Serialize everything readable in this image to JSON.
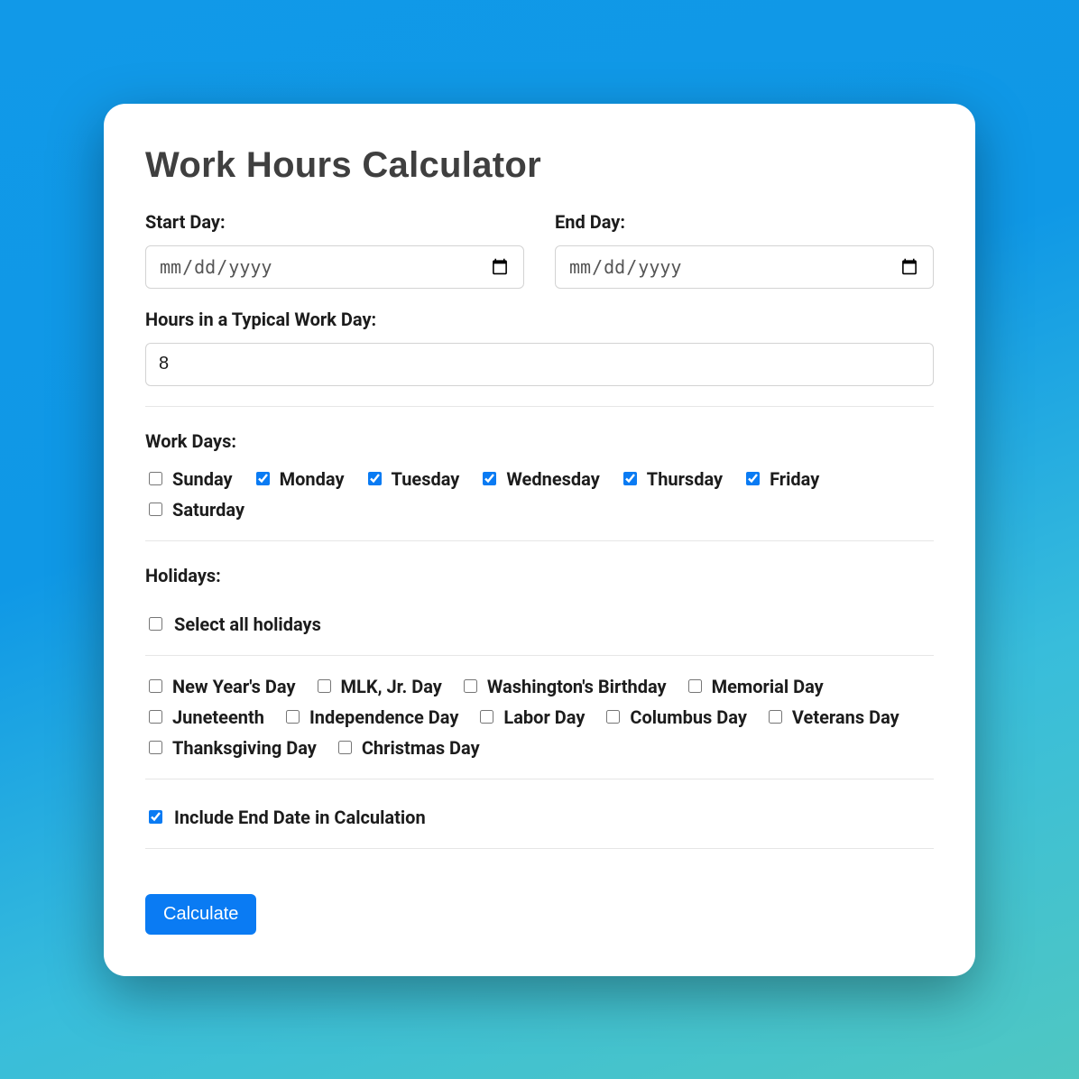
{
  "title": "Work Hours Calculator",
  "startDay": {
    "label": "Start Day:",
    "placeholder": "mm/dd/yyyy"
  },
  "endDay": {
    "label": "End Day:",
    "placeholder": "mm/dd/yyyy"
  },
  "hours": {
    "label": "Hours in a Typical Work Day:",
    "value": "8"
  },
  "workDays": {
    "label": "Work Days:",
    "items": [
      {
        "label": "Sunday",
        "checked": false
      },
      {
        "label": "Monday",
        "checked": true
      },
      {
        "label": "Tuesday",
        "checked": true
      },
      {
        "label": "Wednesday",
        "checked": true
      },
      {
        "label": "Thursday",
        "checked": true
      },
      {
        "label": "Friday",
        "checked": true
      },
      {
        "label": "Saturday",
        "checked": false
      }
    ]
  },
  "holidays": {
    "label": "Holidays:",
    "selectAllLabel": "Select all holidays",
    "selectAllChecked": false,
    "items": [
      {
        "label": "New Year's Day",
        "checked": false
      },
      {
        "label": "MLK, Jr. Day",
        "checked": false
      },
      {
        "label": "Washington's Birthday",
        "checked": false
      },
      {
        "label": "Memorial Day",
        "checked": false
      },
      {
        "label": "Juneteenth",
        "checked": false
      },
      {
        "label": "Independence Day",
        "checked": false
      },
      {
        "label": "Labor Day",
        "checked": false
      },
      {
        "label": "Columbus Day",
        "checked": false
      },
      {
        "label": "Veterans Day",
        "checked": false
      },
      {
        "label": "Thanksgiving Day",
        "checked": false
      },
      {
        "label": "Christmas Day",
        "checked": false
      }
    ]
  },
  "includeEnd": {
    "label": "Include End Date in Calculation",
    "checked": true
  },
  "calculateLabel": "Calculate"
}
